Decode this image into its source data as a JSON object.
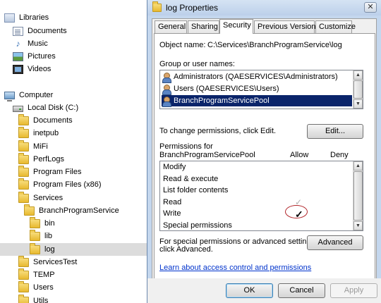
{
  "tree": {
    "items": [
      {
        "label": "Libraries",
        "icon": "library-icon"
      },
      {
        "label": "Documents",
        "icon": "documents-icon"
      },
      {
        "label": "Music",
        "icon": "music-icon"
      },
      {
        "label": "Pictures",
        "icon": "pictures-icon"
      },
      {
        "label": "Videos",
        "icon": "videos-icon"
      },
      {
        "label": "Computer",
        "icon": "computer-icon"
      },
      {
        "label": "Local Disk (C:)",
        "icon": "drive-icon"
      },
      {
        "label": "Documents",
        "icon": "folder-icon"
      },
      {
        "label": "inetpub",
        "icon": "folder-icon"
      },
      {
        "label": "MiFi",
        "icon": "folder-icon"
      },
      {
        "label": "PerfLogs",
        "icon": "folder-icon"
      },
      {
        "label": "Program Files",
        "icon": "folder-icon"
      },
      {
        "label": "Program Files (x86)",
        "icon": "folder-icon"
      },
      {
        "label": "Services",
        "icon": "folder-icon"
      },
      {
        "label": "BranchProgramService",
        "icon": "folder-icon"
      },
      {
        "label": "bin",
        "icon": "folder-icon"
      },
      {
        "label": "lib",
        "icon": "folder-icon"
      },
      {
        "label": "log",
        "icon": "folder-icon",
        "selected": true
      },
      {
        "label": "ServicesTest",
        "icon": "folder-icon"
      },
      {
        "label": "TEMP",
        "icon": "folder-icon"
      },
      {
        "label": "Users",
        "icon": "folder-icon"
      },
      {
        "label": "Utils",
        "icon": "folder-icon"
      }
    ]
  },
  "dialog": {
    "title": "log Properties",
    "close_label": "✕",
    "tabs": [
      "General",
      "Sharing",
      "Security",
      "Previous Versions",
      "Customize"
    ],
    "active_tab": "Security",
    "object_name_label": "Object name:",
    "object_name_value": "C:\\Services\\BranchProgramService\\log",
    "group_label": "Group or user names:",
    "groups": [
      "Administrators (QAESERVICES\\Administrators)",
      "Users (QAESERVICES\\Users)",
      "BranchProgramServicePool"
    ],
    "selected_group": "BranchProgramServicePool",
    "change_text": "To change permissions, click Edit.",
    "edit_button": "Edit...",
    "permissions_for_label": "Permissions for",
    "permissions_for_name": "BranchProgramServicePool",
    "allow_header": "Allow",
    "deny_header": "Deny",
    "permissions": [
      {
        "name": "Modify",
        "allow": "",
        "deny": ""
      },
      {
        "name": "Read & execute",
        "allow": "",
        "deny": ""
      },
      {
        "name": "List folder contents",
        "allow": "",
        "deny": ""
      },
      {
        "name": "Read",
        "allow": "gray",
        "deny": ""
      },
      {
        "name": "Write",
        "allow": "black",
        "deny": ""
      },
      {
        "name": "Special permissions",
        "allow": "",
        "deny": ""
      }
    ],
    "advanced_text_1": "For special permissions or advanced settings,",
    "advanced_text_2": "click Advanced.",
    "advanced_button": "Advanced",
    "learn_link": "Learn about access control and permissions",
    "ok_button": "OK",
    "cancel_button": "Cancel",
    "apply_button": "Apply",
    "check_glyph": "✓",
    "colors": {
      "selection": "#0a246a",
      "link": "#0033cc",
      "annotation": "#b1252a",
      "title_bar": "#c4d7ee"
    }
  }
}
